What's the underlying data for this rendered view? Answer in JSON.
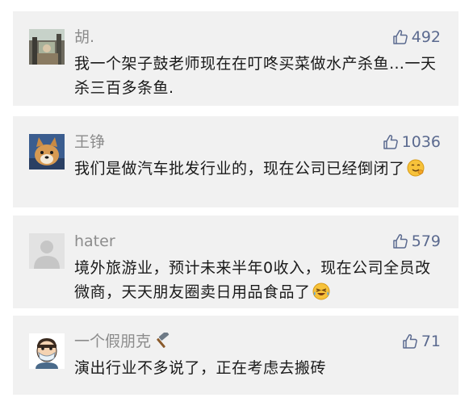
{
  "comments": [
    {
      "name": "胡.",
      "likes": "492",
      "text": "我一个架子鼓老师现在在叮咚买菜做水产杀鱼…一天杀三百多条鱼.",
      "avatar": "photo-avatar"
    },
    {
      "name": "王铮",
      "likes": "1036",
      "text": "我们是做汽车批发行业的，现在公司已经倒闭了",
      "emoji": "awkward-smile-emoji",
      "avatar": "shiba-dog-avatar"
    },
    {
      "name": "hater",
      "likes": "579",
      "text": "境外旅游业，预计未来半年0收入，现在公司全员改微商，天天朋友圈卖日用品食品了",
      "emoji": "crying-laughing-emoji",
      "avatar": "default-avatar"
    },
    {
      "name": "一个假朋克",
      "likes": "71",
      "text": "演出行业不多说了，正在考虑去搬砖",
      "name_icon": "hammer-icon",
      "avatar": "cartoon-mask-avatar"
    }
  ],
  "colors": {
    "card_bg": "#f1f1f1",
    "name": "#8c8c8c",
    "likes": "#5b6a8f",
    "text": "#1a1a1a"
  }
}
